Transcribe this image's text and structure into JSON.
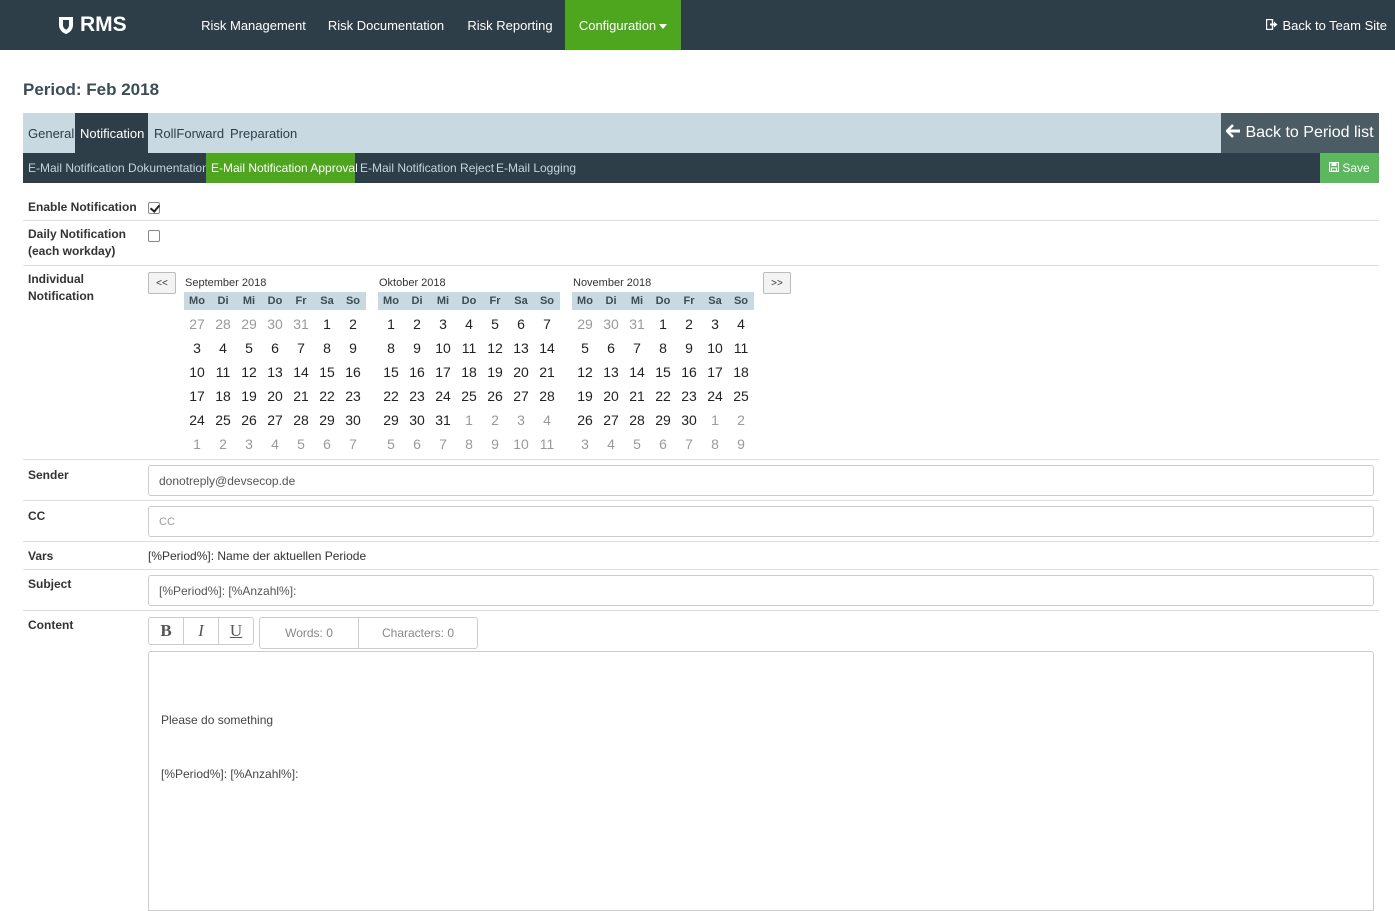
{
  "navbar": {
    "brand": "RMS",
    "items": [
      "Risk Management",
      "Risk Documentation",
      "Risk Reporting",
      "Configuration"
    ],
    "back_team_site": "Back to Team Site"
  },
  "page_title": "Period: Feb 2018",
  "tabs": [
    "General",
    "Notification",
    "RollForward",
    "Preparation"
  ],
  "back_period_label": "Back to Period list",
  "subtabs": [
    "E-Mail Notification Dokumentation",
    "E-Mail Notification Approval",
    "E-Mail Notification Reject",
    "E-Mail Logging"
  ],
  "save_label": "Save",
  "form": {
    "enable_notification": {
      "label": "Enable Notification",
      "checked": true
    },
    "daily_notification": {
      "label_line1": "Daily Notification",
      "label_line2": "(each workday)",
      "checked": false
    },
    "individual_notification": {
      "label_line1": "Individual",
      "label_line2": "Notification"
    },
    "sender": {
      "label": "Sender",
      "value": "donotreply@devsecop.de"
    },
    "cc": {
      "label": "CC",
      "placeholder": "CC"
    },
    "vars": {
      "label": "Vars",
      "text": "[%Period%]: Name der aktuellen Periode"
    },
    "subject": {
      "label": "Subject",
      "value": "[%Period%]: [%Anzahl%]:"
    },
    "content": {
      "label": "Content",
      "bold": "B",
      "italic": "I",
      "underline": "U",
      "words": "Words: 0",
      "characters": "Characters: 0",
      "line1": "Please do something",
      "line2": "[%Period%]: [%Anzahl%]:"
    }
  },
  "calendar": {
    "prev_label": "<<",
    "next_label": ">>",
    "weekdays": [
      "Mo",
      "Di",
      "Mi",
      "Do",
      "Fr",
      "Sa",
      "So"
    ],
    "months": [
      {
        "title": "September 2018",
        "days": [
          [
            "27",
            "28",
            "29",
            "30",
            "31",
            "1",
            "2"
          ],
          [
            "3",
            "4",
            "5",
            "6",
            "7",
            "8",
            "9"
          ],
          [
            "10",
            "11",
            "12",
            "13",
            "14",
            "15",
            "16"
          ],
          [
            "17",
            "18",
            "19",
            "20",
            "21",
            "22",
            "23"
          ],
          [
            "24",
            "25",
            "26",
            "27",
            "28",
            "29",
            "30"
          ],
          [
            "1",
            "2",
            "3",
            "4",
            "5",
            "6",
            "7"
          ]
        ],
        "other": [
          [
            0,
            1,
            2,
            3,
            4
          ],
          [],
          [],
          [],
          [],
          [
            0,
            1,
            2,
            3,
            4,
            5,
            6
          ]
        ]
      },
      {
        "title": "Oktober 2018",
        "days": [
          [
            "1",
            "2",
            "3",
            "4",
            "5",
            "6",
            "7"
          ],
          [
            "8",
            "9",
            "10",
            "11",
            "12",
            "13",
            "14"
          ],
          [
            "15",
            "16",
            "17",
            "18",
            "19",
            "20",
            "21"
          ],
          [
            "22",
            "23",
            "24",
            "25",
            "26",
            "27",
            "28"
          ],
          [
            "29",
            "30",
            "31",
            "1",
            "2",
            "3",
            "4"
          ],
          [
            "5",
            "6",
            "7",
            "8",
            "9",
            "10",
            "11"
          ]
        ],
        "other": [
          [],
          [],
          [],
          [],
          [
            3,
            4,
            5,
            6
          ],
          [
            0,
            1,
            2,
            3,
            4,
            5,
            6
          ]
        ]
      },
      {
        "title": "November 2018",
        "days": [
          [
            "29",
            "30",
            "31",
            "1",
            "2",
            "3",
            "4"
          ],
          [
            "5",
            "6",
            "7",
            "8",
            "9",
            "10",
            "11"
          ],
          [
            "12",
            "13",
            "14",
            "15",
            "16",
            "17",
            "18"
          ],
          [
            "19",
            "20",
            "21",
            "22",
            "23",
            "24",
            "25"
          ],
          [
            "26",
            "27",
            "28",
            "29",
            "30",
            "1",
            "2"
          ],
          [
            "3",
            "4",
            "5",
            "6",
            "7",
            "8",
            "9"
          ]
        ],
        "other": [
          [
            0,
            1,
            2
          ],
          [],
          [],
          [],
          [
            5,
            6
          ],
          [
            0,
            1,
            2,
            3,
            4,
            5,
            6
          ]
        ]
      }
    ]
  },
  "colors": {
    "navbar": "#2d3e48",
    "accent_green": "#4ea51e",
    "tabbar": "#c9d9e1",
    "save_green": "#5cb85c"
  }
}
